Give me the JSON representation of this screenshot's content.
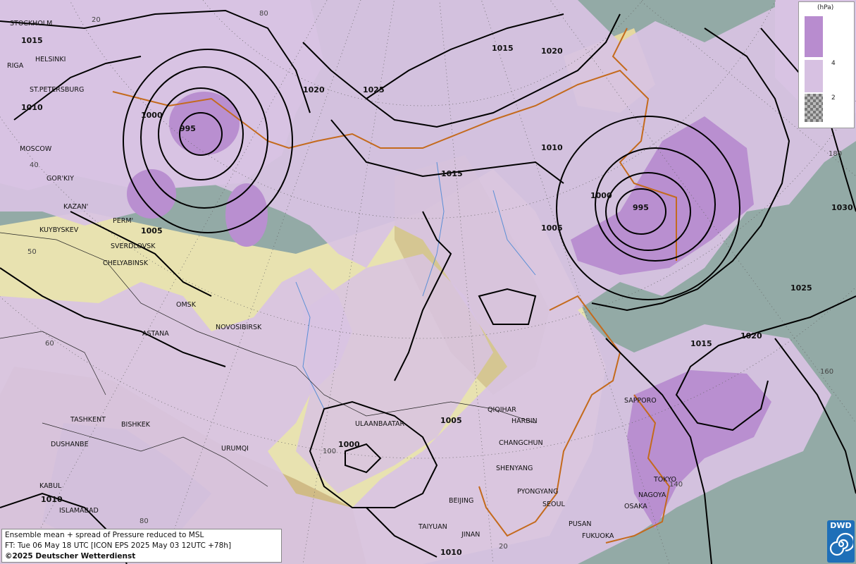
{
  "legend": {
    "unit": "(hPa)",
    "ticks": [
      "4",
      "2"
    ],
    "colors": {
      "high": "#b88ccf",
      "mid": "#d7c1e2",
      "low_pattern": "checker"
    }
  },
  "info": {
    "line1": "Ensemble mean + spread of Pressure reduced to MSL",
    "line2": "FT: Tue 06 May 18 UTC [ICON EPS 2025 May 03 12UTC +78h]",
    "copyright": "©2025 Deutscher Wetterdienst"
  },
  "logo": {
    "text": "DWD"
  },
  "isobar_labels": [
    "1015",
    "1010",
    "1005",
    "1000",
    "995",
    "1020",
    "1025",
    "1020",
    "1015",
    "1010",
    "1005",
    "1000",
    "995",
    "1030",
    "1025",
    "1020",
    "1015",
    "1005",
    "1000",
    "1010",
    "1010",
    "1015"
  ],
  "cities": [
    "STOCKHOLM",
    "HELSINKI",
    "RIGA",
    "ST.PETERSBURG",
    "MOSCOW",
    "GOR'KIY",
    "KAZAN'",
    "PERM'",
    "KUYBYSKEV",
    "SVERDLOVSK",
    "CHELYABINSK",
    "OMSK",
    "ASTANA",
    "NOVOSIBIRSK",
    "TASHKENT",
    "BISHKEK",
    "DUSHANBE",
    "URUMQI",
    "KABUL",
    "ISLAMABAD",
    "ULAANBAATAR",
    "QIQIHAR",
    "HARBIN",
    "CHANGCHUN",
    "SHENYANG",
    "PYONGYANG",
    "SEOUL",
    "BEIJING",
    "TAIYUAN",
    "JINAN",
    "PUSAN",
    "FUKUOKA",
    "NAGOYA",
    "OSAKA",
    "TOKYO",
    "SAPPORO"
  ],
  "grid_labels": [
    "20",
    "80",
    "40",
    "50",
    "60",
    "100",
    "80",
    "20",
    "180",
    "160",
    "140"
  ],
  "colors": {
    "spread_low": "#93aaa6",
    "spread_mid": "#d8c3e3",
    "spread_high": "#b98fd0",
    "isobar": "#000000",
    "coast": "#c46a1c",
    "terrain": "#e9e0a8"
  }
}
